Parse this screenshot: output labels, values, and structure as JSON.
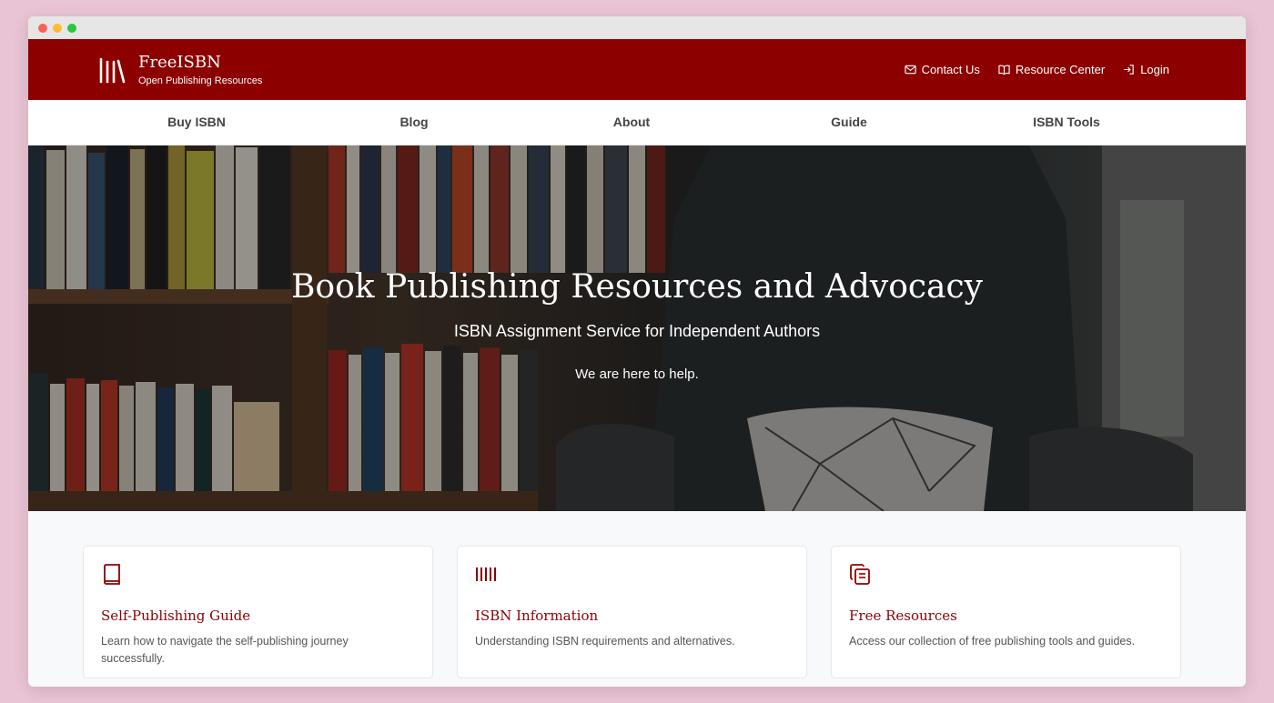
{
  "window": {
    "controls": [
      "close",
      "minimize",
      "maximize"
    ],
    "colors": {
      "close": "#ff5f57",
      "minimize": "#febc2e",
      "maximize": "#28c840"
    }
  },
  "brand": {
    "name": "FreeISBN",
    "tagline": "Open Publishing Resources",
    "icon": "library-books-icon",
    "color": "#8c0000"
  },
  "utility_nav": [
    {
      "label": "Contact Us",
      "icon": "envelope-icon"
    },
    {
      "label": "Resource Center",
      "icon": "open-book-icon"
    },
    {
      "label": "Login",
      "icon": "login-arrow-icon"
    }
  ],
  "main_nav": [
    {
      "label": "Buy ISBN"
    },
    {
      "label": "Blog"
    },
    {
      "label": "About"
    },
    {
      "label": "Guide"
    },
    {
      "label": "ISBN Tools"
    }
  ],
  "hero": {
    "title": "Book Publishing Resources and Advocacy",
    "subtitle": "ISBN Assignment Service for Independent Authors",
    "tagline": "We are here to help.",
    "background": "bookshelf-and-armchair-photo"
  },
  "cards": [
    {
      "icon": "book-icon",
      "title": "Self-Publishing Guide",
      "description": "Learn how to navigate the self-publishing journey successfully."
    },
    {
      "icon": "barcode-icon",
      "title": "ISBN Information",
      "description": "Understanding ISBN requirements and alternatives."
    },
    {
      "icon": "copy-documents-icon",
      "title": "Free Resources",
      "description": "Access our collection of free publishing tools and guides."
    }
  ]
}
